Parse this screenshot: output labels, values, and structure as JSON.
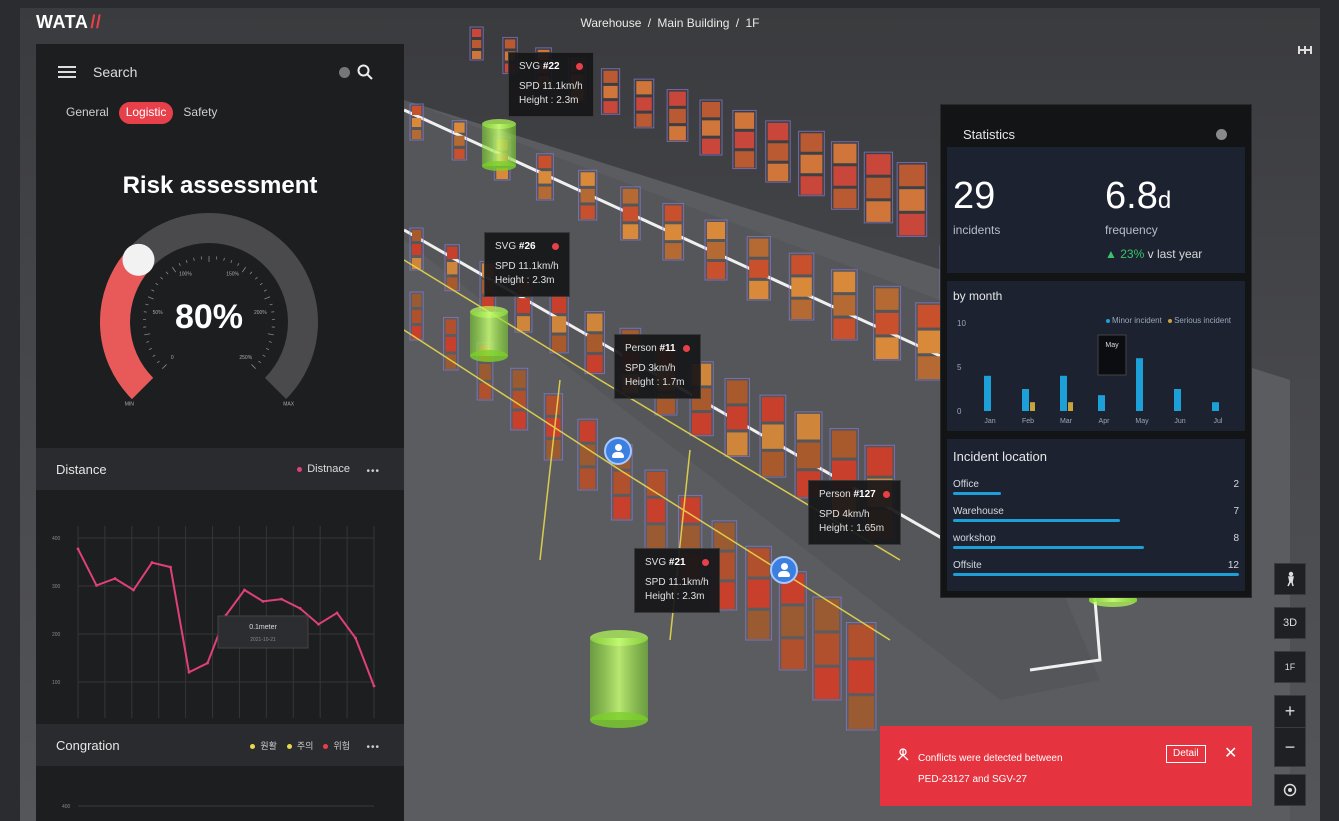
{
  "app": {
    "logo": "WATA",
    "logo_mark": "//"
  },
  "breadcrumb": [
    "Warehouse",
    "Main Building",
    "1F"
  ],
  "search": {
    "label": "Search"
  },
  "tabs": [
    {
      "label": "General",
      "active": false
    },
    {
      "label": "Logistic",
      "active": true
    },
    {
      "label": "Safety",
      "active": false
    }
  ],
  "risk": {
    "title": "Risk assessment",
    "percent_label": "80%",
    "value": 0.8,
    "min_label": "MIN",
    "max_label": "MAX",
    "ticks": [
      "0",
      "50%",
      "100%",
      "150%",
      "200%",
      "250%"
    ]
  },
  "distance": {
    "title": "Distance",
    "legend": "Distnace",
    "tooltip_title": "0.1meter",
    "tooltip_date": "2021-10-21",
    "y_ticks": [
      "400",
      "300",
      "200",
      "100"
    ]
  },
  "congestion": {
    "title": "Congration",
    "legend": [
      "원활",
      "주의",
      "위험"
    ],
    "y_ticks": [
      "400"
    ]
  },
  "vehicles": [
    {
      "name": "SVG",
      "id": "#22",
      "speed": "SPD 11.1km/h",
      "height": "Height : 2.3m"
    },
    {
      "name": "SVG",
      "id": "#26",
      "speed": "SPD 11.1km/h",
      "height": "Height : 2.3m"
    },
    {
      "name": "Person",
      "id": "#11",
      "speed": "SPD 3km/h",
      "height": "Height : 1.7m"
    },
    {
      "name": "Person",
      "id": "#127",
      "speed": "SPD 4km/h",
      "height": "Height : 1.65m"
    },
    {
      "name": "SVG",
      "id": "#21",
      "speed": "SPD 11.1km/h",
      "height": "Height : 2.3m"
    }
  ],
  "stats": {
    "title": "Statistics",
    "incidents": {
      "value": "29",
      "label": "incidents"
    },
    "frequency": {
      "value": "6.8",
      "unit": "d",
      "label": "frequency"
    },
    "change": {
      "arrow": "▲",
      "value": "23%",
      "suffix": "v last year"
    },
    "by_month": {
      "title": "by month",
      "legend_minor": "Minor incident",
      "legend_serious": "Serious incident",
      "tooltip": "May",
      "y_ticks": [
        "10",
        "5",
        "0"
      ]
    },
    "location": {
      "title": "Incident location",
      "items": [
        {
          "name": "Office",
          "value": "2",
          "count": 2
        },
        {
          "name": "Warehouse",
          "value": "7",
          "count": 7
        },
        {
          "name": "workshop",
          "value": "8",
          "count": 8
        },
        {
          "name": "Offsite",
          "value": "12",
          "count": 12
        }
      ]
    }
  },
  "toolbar": {
    "view_3d": "3D",
    "floor": "1F",
    "zoom_in": "+",
    "zoom_out": "−"
  },
  "alert": {
    "line1": "Conflicts were detected between",
    "line2": "PED-23127 and SGV-27",
    "detail": "Detail",
    "close": "✕"
  },
  "colors": {
    "accent": "#e8404a",
    "chart_line": "#e0407a",
    "minor_bar": "#1d9fd8",
    "serious_bar": "#c8a43a",
    "cylinder": "#9ae63b"
  },
  "chart_data": [
    {
      "type": "line",
      "name": "Distance",
      "series": [
        {
          "name": "Distnace",
          "values": [
            370,
            290,
            305,
            280,
            340,
            330,
            100,
            120,
            225,
            280,
            255,
            260,
            240,
            205,
            230,
            175,
            70
          ]
        }
      ],
      "ylim": [
        0,
        420
      ]
    },
    {
      "type": "bar",
      "name": "by month",
      "categories": [
        "Jan",
        "Feb",
        "Mar",
        "Apr",
        "May",
        "Jun",
        "Jul"
      ],
      "series": [
        {
          "name": "Minor incident",
          "values": [
            4,
            2.5,
            4,
            1.8,
            6,
            2.5,
            1
          ]
        },
        {
          "name": "Serious incident",
          "values": [
            0,
            1,
            1,
            0,
            0,
            0,
            0
          ]
        }
      ],
      "ylim": [
        0,
        10
      ]
    }
  ]
}
